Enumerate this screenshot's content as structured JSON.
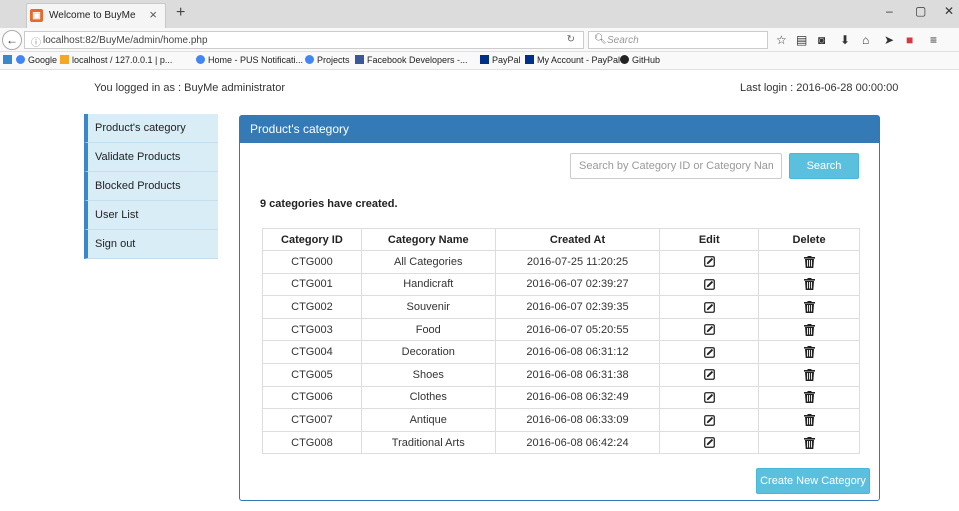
{
  "browser": {
    "tab_title": "Welcome to BuyMe",
    "tab_close": "×",
    "new_tab": "+",
    "url": "localhost:82/BuyMe/admin/home.php",
    "search_placeholder": "Search",
    "window_controls": [
      "–",
      "▢",
      "✕"
    ],
    "bookmarks": [
      {
        "label": "Google",
        "icon": "google-icon",
        "color": "#4285f4"
      },
      {
        "label": "localhost / 127.0.0.1 | p...",
        "icon": "phpmyadmin-icon",
        "color": "#f5a623"
      },
      {
        "label": "Home - PUS Notificati...",
        "icon": "google-icon",
        "color": "#4285f4"
      },
      {
        "label": "Projects",
        "icon": "google-icon",
        "color": "#4285f4"
      },
      {
        "label": "Facebook Developers -...",
        "icon": "facebook-icon",
        "color": "#3b5998"
      },
      {
        "label": "PayPal",
        "icon": "paypal-icon",
        "color": "#003087"
      },
      {
        "label": "My Account - PayPal",
        "icon": "paypal-icon",
        "color": "#003087"
      },
      {
        "label": "GitHub",
        "icon": "github-icon",
        "color": "#222222"
      }
    ]
  },
  "header": {
    "logged_in": "You logged in as : BuyMe administrator",
    "last_login": "Last login : 2016-06-28 00:00:00"
  },
  "sidebar": {
    "items": [
      {
        "label": "Product's category"
      },
      {
        "label": "Validate Products"
      },
      {
        "label": "Blocked Products"
      },
      {
        "label": "User List"
      },
      {
        "label": "Sign out"
      }
    ]
  },
  "panel": {
    "title": "Product's category",
    "search_placeholder": "Search by Category ID or Category Name",
    "search_button": "Search",
    "count_text": "9 categories have created.",
    "create_button": "Create New Category",
    "columns": [
      "Category ID",
      "Category Name",
      "Created At",
      "Edit",
      "Delete"
    ],
    "rows": [
      {
        "id": "CTG000",
        "name": "All Categories",
        "created": "2016-07-25 11:20:25"
      },
      {
        "id": "CTG001",
        "name": "Handicraft",
        "created": "2016-06-07 02:39:27"
      },
      {
        "id": "CTG002",
        "name": "Souvenir",
        "created": "2016-06-07 02:39:35"
      },
      {
        "id": "CTG003",
        "name": "Food",
        "created": "2016-06-07 05:20:55"
      },
      {
        "id": "CTG004",
        "name": "Decoration",
        "created": "2016-06-08 06:31:12"
      },
      {
        "id": "CTG005",
        "name": "Shoes",
        "created": "2016-06-08 06:31:38"
      },
      {
        "id": "CTG006",
        "name": "Clothes",
        "created": "2016-06-08 06:32:49"
      },
      {
        "id": "CTG007",
        "name": "Antique",
        "created": "2016-06-08 06:33:09"
      },
      {
        "id": "CTG008",
        "name": "Traditional Arts",
        "created": "2016-06-08 06:42:24"
      }
    ]
  },
  "colors": {
    "primary": "#337ab7",
    "info": "#5bc0de",
    "sidebar_bg": "#d9edf7",
    "sidebar_accent": "#3a87ca"
  }
}
